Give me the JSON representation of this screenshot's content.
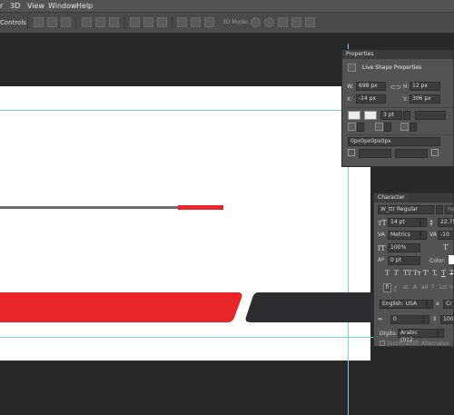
{
  "menubar": {
    "items": [
      "r",
      "3D",
      "View",
      "Window",
      "Help"
    ]
  },
  "options": {
    "controls_label": "Controls",
    "mode_3d_label": "3D Mode:"
  },
  "properties": {
    "tab": "Properties",
    "section_title": "Live Shape Properties",
    "w_label": "W:",
    "w_value": "698 px",
    "h_label": "H:",
    "h_value": "12 px",
    "x_label": "X:",
    "x_value": "-14 px",
    "y_label": "Y:",
    "y_value": "306 px",
    "stroke_value": "3 pt",
    "radius_value": "0px0px0px0px"
  },
  "character": {
    "tab": "Character",
    "font_family": "W_ttr Regular",
    "font_style": "Regu",
    "font_size": "14 pt",
    "leading": "22.75",
    "kerning": "Metrics",
    "tracking": "-10",
    "vscale": "100%",
    "baseline": "0 pt",
    "color_label": "Color:",
    "type_buttons": [
      "T",
      "T",
      "TT",
      "Tт",
      "T'",
      "T,",
      "T",
      "T"
    ],
    "opentype_buttons": [
      "fi",
      "ꝭ",
      "st",
      "A",
      "ad",
      "T",
      "1st",
      "½"
    ],
    "language": "English: USA",
    "aa_label": "a",
    "aa_value": "Cr",
    "small_value": "0",
    "small_value2": "100",
    "digits_label": "Digits:",
    "digits_value": "Arabic (012...",
    "justification_alternates": "Justification Alternates"
  },
  "colors": {
    "red": "#e8262a",
    "dark": "#2d2d2f",
    "gray_line": "#6d6d6d",
    "guide": "#6fd6e6"
  }
}
